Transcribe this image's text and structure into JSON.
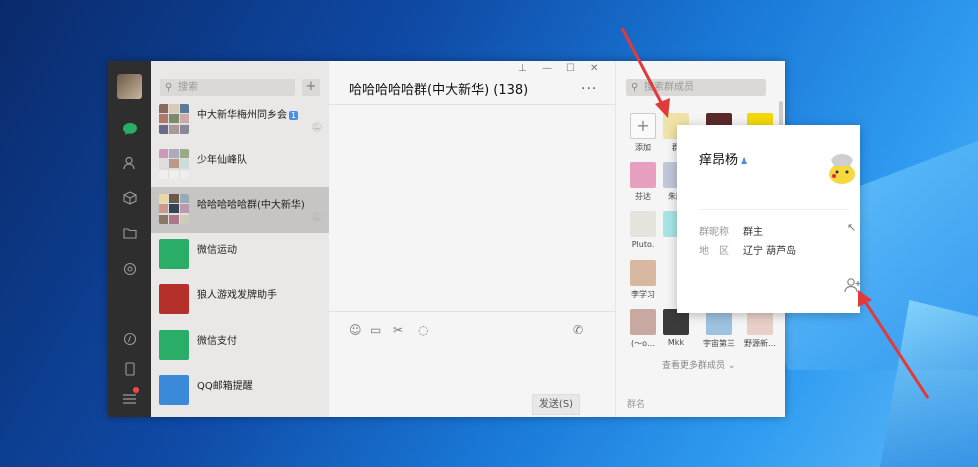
{
  "window": {
    "controls": [
      "⊥",
      "—",
      "☐",
      "✕"
    ]
  },
  "sidebar_rail": {
    "icons": [
      "chat-icon",
      "contacts-icon",
      "box-icon",
      "folder-icon",
      "moments-icon",
      "miniprogram-icon",
      "phone-icon",
      "menu-icon"
    ],
    "accent": "#2aae67"
  },
  "chat_list": {
    "search_placeholder": "搜索",
    "add_label": "+",
    "items": [
      {
        "name": "中大新华梅州同乡会",
        "badge": "1"
      },
      {
        "name": "少年仙峰队"
      },
      {
        "name": "哈哈哈哈哈群(中大新华)"
      },
      {
        "name": "微信运动"
      },
      {
        "name": "狼人游戏发牌助手"
      },
      {
        "name": "微信支付"
      },
      {
        "name": "QQ邮箱提醒"
      }
    ]
  },
  "chat": {
    "title": "哈哈哈哈哈群(中大新华) (138)",
    "more": "...",
    "send_label": "发送(S)"
  },
  "members": {
    "search_placeholder": "搜索群成员",
    "items": [
      "添加",
      "群",
      "芬达",
      "朱鹏",
      "Pluto.",
      "李学习",
      "(～o…",
      "Mkk",
      "宇宙第三",
      "野源新…"
    ],
    "view_more": "查看更多群成员",
    "group_name_label": "群名"
  },
  "profile_card": {
    "name": "痒昂杨",
    "fields": [
      {
        "key": "群昵称",
        "value": "群主"
      },
      {
        "key": "地　区",
        "value": "辽宁  葫芦岛"
      }
    ]
  },
  "colors": {
    "wechat_green": "#2aae67",
    "arrow_red": "#e03a3a"
  }
}
